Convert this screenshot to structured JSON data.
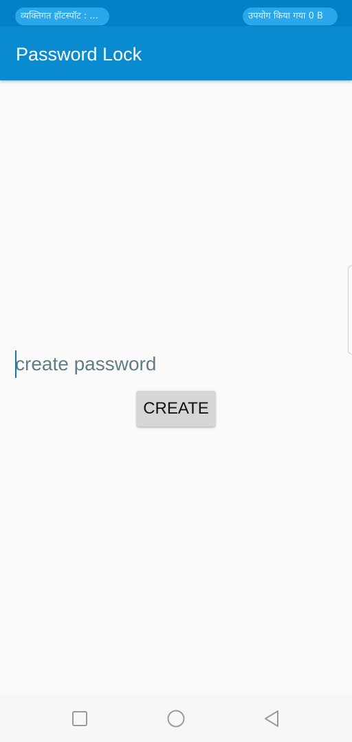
{
  "status_bar": {
    "hotspot_text": "व्यक्तिगत हॉटस्पॉट : ...",
    "usage_text": "उपयोग किया गया 0 B"
  },
  "app_bar": {
    "title": "Password Lock"
  },
  "form": {
    "password_placeholder": "create password",
    "password_value": "",
    "create_button_label": "CREATE"
  },
  "nav_bar": {
    "icons": [
      "recent-apps-icon",
      "home-icon",
      "back-icon"
    ]
  },
  "colors": {
    "status_bar": "#0380c6",
    "app_bar": "#0a8bd0",
    "pill": "#2aa7ea",
    "background": "#fafafa",
    "button": "#d6d6d6",
    "placeholder": "#607d8b"
  }
}
